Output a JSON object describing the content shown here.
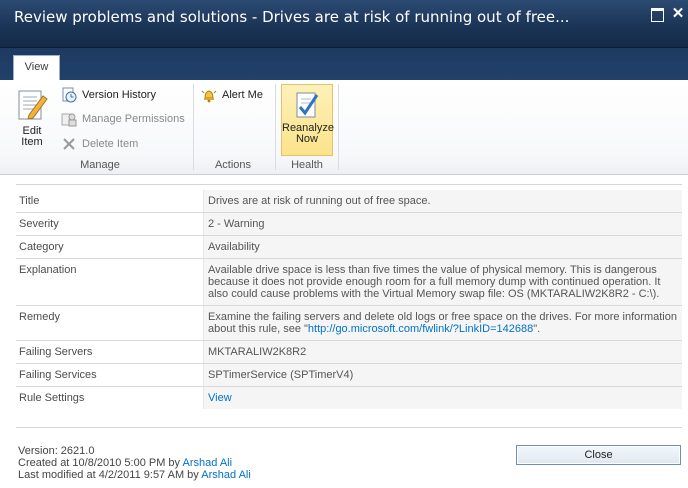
{
  "window": {
    "title": "Review problems and solutions - Drives are at risk of running out of free..."
  },
  "ribbon": {
    "tab": "View",
    "groups": {
      "manage": {
        "label": "Manage",
        "edit_item": [
          "Edit",
          "Item"
        ],
        "version_history": "Version History",
        "manage_permissions": "Manage Permissions",
        "delete_item": "Delete Item"
      },
      "actions": {
        "label": "Actions",
        "alert_me": "Alert Me"
      },
      "health": {
        "label": "Health",
        "reanalyze_now": [
          "Reanalyze",
          "Now"
        ]
      }
    }
  },
  "properties": [
    {
      "name": "Title",
      "value": "Drives are at risk of running out of free space."
    },
    {
      "name": "Severity",
      "value": "2 - Warning"
    },
    {
      "name": "Category",
      "value": "Availability"
    },
    {
      "name": "Explanation",
      "value": "Available drive space is less than five times the value of physical memory. This is dangerous because it does not provide enough room for a full memory dump with continued operation. It also could cause problems with the Virtual Memory swap file: OS (MKTARALIW2K8R2 - C:\\)."
    },
    {
      "name": "Remedy",
      "value_prefix": "Examine the failing servers and delete old logs or free space on the drives. For more information about this rule, see \"",
      "link": "http://go.microsoft.com/fwlink/?LinkID=142688",
      "value_suffix": "\"."
    },
    {
      "name": "Failing Servers",
      "value": "MKTARALIW2K8R2"
    },
    {
      "name": "Failing Services",
      "value": "SPTimerService (SPTimerV4)"
    },
    {
      "name": "Rule Settings",
      "link": "View"
    }
  ],
  "footer": {
    "version": "Version: 2621.0",
    "created_prefix": "Created at 10/8/2010 5:00 PM by ",
    "created_by": "Arshad Ali",
    "modified_prefix": "Last modified at 4/2/2011 9:57 AM by ",
    "modified_by": "Arshad Ali",
    "close_label": "Close"
  },
  "icons": {
    "edit_item": "edit-document-icon",
    "version_history": "version-history-icon",
    "manage_permissions": "permissions-icon",
    "delete_item": "delete-x-icon",
    "alert_me": "alert-bell-icon",
    "reanalyze_now": "reanalyze-check-icon",
    "window_maximize": "maximize-icon",
    "window_close": "close-icon"
  },
  "colors": {
    "title_bar": "#1b3557",
    "link": "#0072c6",
    "highlight": "#fbe38a"
  }
}
